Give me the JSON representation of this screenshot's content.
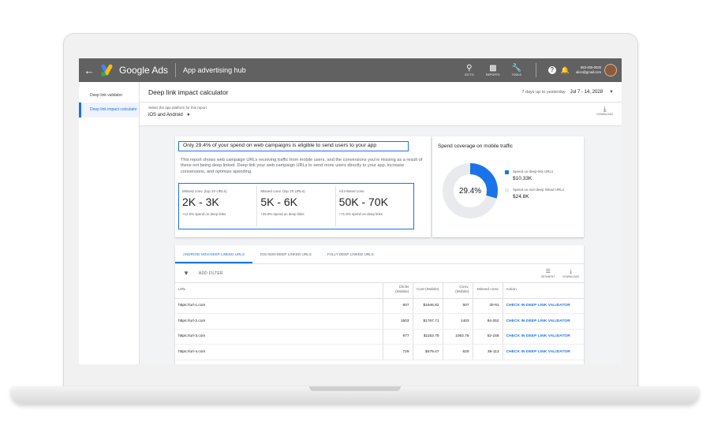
{
  "header": {
    "brand": "Google Ads",
    "hub_title": "App advertising hub",
    "tools": [
      {
        "icon": "search-icon",
        "label": "GO TO"
      },
      {
        "icon": "reports-icon",
        "label": "REPORTS"
      },
      {
        "icon": "wrench-icon",
        "label": "TOOLS"
      }
    ],
    "account_phone": "683-455-0020",
    "account_email": "alice@gmail.com"
  },
  "sidebar": {
    "items": [
      {
        "label": "Deep link validator",
        "active": false
      },
      {
        "label": "Deep link impact calculator",
        "active": true
      }
    ]
  },
  "page": {
    "title": "Deep link impact calculator",
    "date_range_label": "7 days up to yesterday",
    "date_range": "Jul 7 - 14, 2028",
    "platform_label": "Select the app platform for this report",
    "platform_value": "iOS and Android",
    "download_label": "DOWNLOAD"
  },
  "impact": {
    "headline": "Only 29.4% of your spend on web campaigns is eligible to send users to your app",
    "description": "This report shows web campaign URLs receiving traffic from mobile users, and the conversions you're missing as a result of these not being deep linked. Deep link your web campaign URLs to send more users directly to your app, increase conversions, and optimize spending.",
    "metrics": [
      {
        "label": "Missed conv. (top 10 URLs)",
        "value": "2K - 3K",
        "sub": "+12.5% spend on deep links"
      },
      {
        "label": "Missed conv. (top 20 URLs)",
        "value": "5K - 6K",
        "sub": "+25.9% spend on deep links"
      },
      {
        "label": "All missed conv.",
        "value": "50K - 70K",
        "sub": "+71.6% spend on deep links"
      }
    ]
  },
  "coverage": {
    "title": "Spend coverage on mobile traffic",
    "center_label": "29.4%",
    "fraction_deep_linked": 0.294,
    "colors": {
      "deep_linked": "#1a73e8",
      "non_deep_linked": "#e8eaed"
    },
    "legend": [
      {
        "name": "Spend on deep-link URLs",
        "value": "$10.33K",
        "color": "#1a73e8"
      },
      {
        "name": "Spend on non-deep linked URLs",
        "value": "$24.8K",
        "color": "#e8eaed"
      }
    ]
  },
  "table": {
    "tabs": [
      {
        "label": "ANDROID NON-DEEP LINKED URLS",
        "active": true
      },
      {
        "label": "IOS NON-DEEP LINKED URLS",
        "active": false
      },
      {
        "label": "FULLY DEEP LINKED URLS",
        "active": false
      }
    ],
    "filter_label": "ADD FILTER",
    "actions": [
      {
        "icon": "segment-icon",
        "label": "SEGMENT"
      },
      {
        "icon": "download-icon",
        "label": "DOWNLOAD"
      }
    ],
    "columns": [
      "URL",
      "Clicks (Mobile)",
      "Cost (Mobile)",
      "Conv. (Mobile)",
      "Missed conv.",
      "Action"
    ],
    "rows": [
      [
        "https://url-1.com",
        "607",
        "$1846.82",
        "507",
        "30-91",
        "CHECK IN DEEP LINK VALIDATOR"
      ],
      [
        "https://url-2.com",
        "1503",
        "$1767.71",
        "1403",
        "84-252",
        "CHECK IN DEEP LINK VALIDATOR"
      ],
      [
        "https://url-3.com",
        "977",
        "$1163.75",
        "1063.75",
        "52-158",
        "CHECK IN DEEP LINK VALIDATOR"
      ],
      [
        "https://url-4.com",
        "729",
        "$479.47",
        "629",
        "38-113",
        "CHECK IN DEEP LINK VALIDATOR"
      ]
    ]
  }
}
